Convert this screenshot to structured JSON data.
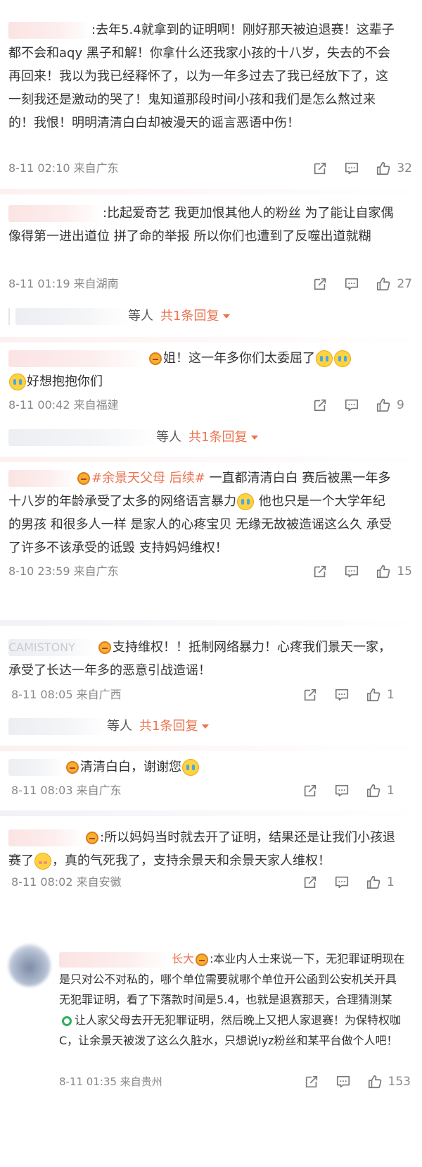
{
  "comments": [
    {
      "text": ":去年5.4就拿到的证明啊！刚好那天被迫退赛！这辈子都不会和aqy 黑子和解！你拿什么还我家小孩的十八岁，失去的不会再回来！我以为我已经释怀了，以为一年多过去了我已经放下了，这一刻我还是激动的哭了！鬼知道那段时间小孩和我们是怎么熬过来的！我恨！明明清清白白却被漫天的谣言恶语中伤！",
      "time": "8-11 02:10 来自广东",
      "likes": "32"
    },
    {
      "text": ":比起爱奇艺 我更加恨其他人的粉丝 为了能让自家偶像得第一进出道位 拼了命的举报 所以你们也遭到了反噬出道就糊",
      "time": "8-11 01:19 来自湖南",
      "likes": "27"
    },
    {
      "text_a": "姐！这一年多你们太委屈了",
      "text_b": "好想抱抱你们",
      "time": "8-11 00:42 来自福建",
      "likes": "9"
    },
    {
      "hashtag": "#余景天父母 后续#",
      "text_a": " 一直都清清白白 赛后被黑一年多 十八岁的年龄承受了太多的网络语言暴力",
      "text_b": " 他也只是一个大学年纪的男孩 和很多人一样 是家人的心疼宝贝 无缘无故被造谣这么久 承受了许多不该承受的诋毁 支持妈妈维权！",
      "time": "8-10 23:59 来自广东",
      "likes": "15"
    },
    {
      "name_fragment": "CAMISTONY",
      "text": "支持维权！！抵制网络暴力！心疼我们景天一家，承受了长达一年多的恶意引战造谣！",
      "time": "8-11 08:05 来自广西",
      "likes": "1"
    },
    {
      "text": "清清白白，谢谢您",
      "time": "8-11 08:03 来自广东",
      "likes": "1"
    },
    {
      "text_a": ":所以妈妈当时就去开了证明，结果还是让我们小孩退赛了",
      "text_b": "，真的气死我了，支持余景天和余景天家人维权！",
      "time": "8-11 08:02 来自安徽",
      "likes": "1"
    },
    {
      "name_fragment": "长大",
      "text_a": ":本业内人士来说一下，无犯罪证明现在是只对公不对私的，哪个单位需要就哪个单位开公函到公安机关开具无犯罪证明，看了下落款时间是5.4，也就是退赛那天，合理猜测某",
      "text_b": "让人家父母去开无犯罪证明，然后晚上又把人家退赛！为保特权咖C，让余景天被泼了这么久脏水，只想说lyz粉丝和某平台做个人吧！",
      "time": "8-11 01:35 来自贵州",
      "likes": "153"
    }
  ],
  "replies": [
    {
      "label": "等人",
      "more": "共1条回复"
    },
    {
      "label": "等人",
      "more": "共1条回复"
    },
    {
      "label": "等人",
      "more": "共1条回复"
    }
  ],
  "colors": {
    "accent": "#eb7350",
    "meta": "#888888",
    "text": "#333333"
  },
  "icons": [
    "share-icon",
    "comment-icon",
    "like-icon",
    "crown-badge-icon",
    "crying-emoji-icon"
  ]
}
